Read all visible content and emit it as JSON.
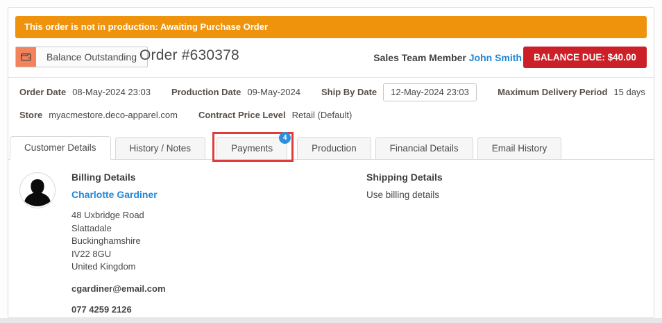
{
  "banner": {
    "text": "This order is not in production: Awaiting Purchase Order"
  },
  "header": {
    "status_button_label": "Balance Outstanding",
    "order_title": "Order #630378",
    "sales_team_label": "Sales Team Member",
    "sales_team_member": "John Smith",
    "balance_due_label": "BALANCE DUE: $40.00"
  },
  "details": {
    "order_date_label": "Order Date",
    "order_date_value": "08-May-2024 23:03",
    "production_date_label": "Production Date",
    "production_date_value": "09-May-2024",
    "ship_by_date_label": "Ship By Date",
    "ship_by_date_value": "12-May-2024 23:03",
    "max_delivery_label": "Maximum Delivery Period",
    "max_delivery_value": "15 days",
    "store_label": "Store",
    "store_value": "myacmestore.deco-apparel.com",
    "contract_price_label": "Contract Price Level",
    "contract_price_value": "Retail (Default)"
  },
  "tabs": [
    {
      "label": "Customer Details",
      "active": true
    },
    {
      "label": "History / Notes"
    },
    {
      "label": "Payments",
      "badge": "4",
      "highlighted": true
    },
    {
      "label": "Production"
    },
    {
      "label": "Financial Details"
    },
    {
      "label": "Email History"
    }
  ],
  "billing": {
    "heading": "Billing Details",
    "name": "Charlotte Gardiner",
    "address_lines": [
      "48 Uxbridge Road",
      "Slattadale",
      "Buckinghamshire",
      "IV22 8GU",
      "United Kingdom"
    ],
    "email": "cgardiner@email.com",
    "phone": "077 4259 2126"
  },
  "shipping": {
    "heading": "Shipping Details",
    "text": "Use billing details"
  },
  "colors": {
    "banner_orange": "#ef930d",
    "status_icon_salmon": "#f2835c",
    "balance_red": "#cb2027",
    "link_blue": "#2088d8",
    "tab_badge_blue": "#2c90de",
    "annotation_red": "#e23b3b"
  }
}
